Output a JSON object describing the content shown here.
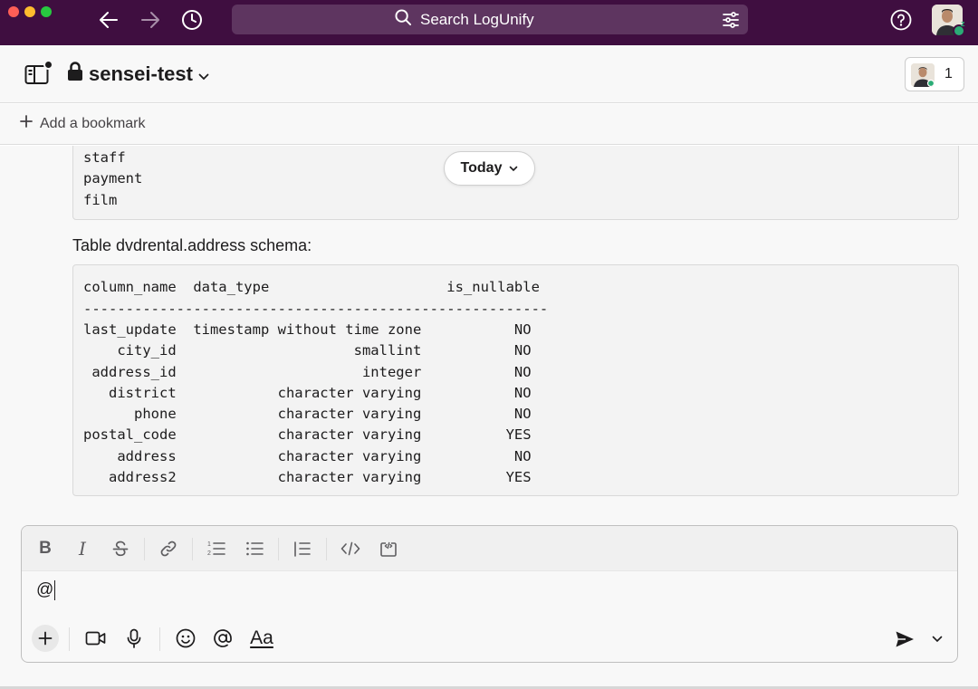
{
  "window": {
    "traffic_lights": [
      "close",
      "minimize",
      "zoom"
    ]
  },
  "topbar": {
    "search_placeholder": "Search LogUnify",
    "background_color": "#3f0e40"
  },
  "channel": {
    "name": "sensei-test",
    "member_count": "1"
  },
  "bookmarks": {
    "add_label": "Add a bookmark"
  },
  "messages": {
    "tables_list": [
      "staff",
      "payment",
      "film"
    ],
    "date_divider": "Today",
    "schema_caption": "Table dvdrental.address schema:",
    "schema": {
      "header": "column_name  data_type                     is_nullable",
      "separator": "-------------------------------------------------------",
      "rows": [
        "last_update  timestamp without time zone           NO",
        "    city_id                     smallint           NO",
        " address_id                      integer           NO",
        "   district            character varying           NO",
        "      phone            character varying           NO",
        "postal_code            character varying          YES",
        "    address            character varying           NO",
        "   address2            character varying          YES"
      ]
    }
  },
  "composer": {
    "text": "@",
    "format_buttons": [
      "bold",
      "italic",
      "strikethrough",
      "link",
      "ordered-list",
      "bulleted-list",
      "blockquote",
      "code",
      "code-block"
    ],
    "aa_label": "Aa"
  }
}
